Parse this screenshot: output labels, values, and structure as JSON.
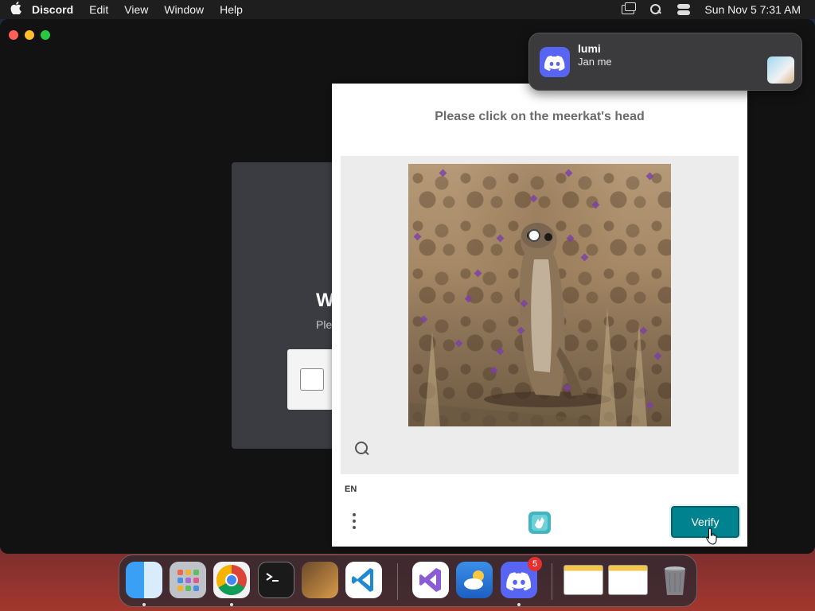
{
  "menubar": {
    "apple": "",
    "app_name": "Discord",
    "items": [
      "Edit",
      "View",
      "Window",
      "Help"
    ],
    "clock": "Sun Nov 5  7:31 AM"
  },
  "login": {
    "title": "W",
    "subtitle": "Ple"
  },
  "captcha": {
    "prompt": "Please click on the meerkat's head",
    "language": "EN",
    "verify_label": "Verify"
  },
  "notification": {
    "app_icon": "discord-icon",
    "title": "lumi",
    "body": "Jan me"
  },
  "dock": {
    "items": [
      "finder",
      "launchpad",
      "chrome",
      "terminal",
      "garageband",
      "vscode",
      "visual-studio",
      "weather",
      "discord",
      "chrome-window-1",
      "chrome-window-2",
      "trash"
    ],
    "discord_badge": "5"
  },
  "colors": {
    "verify": "#00838f",
    "discord": "#5865f2"
  }
}
